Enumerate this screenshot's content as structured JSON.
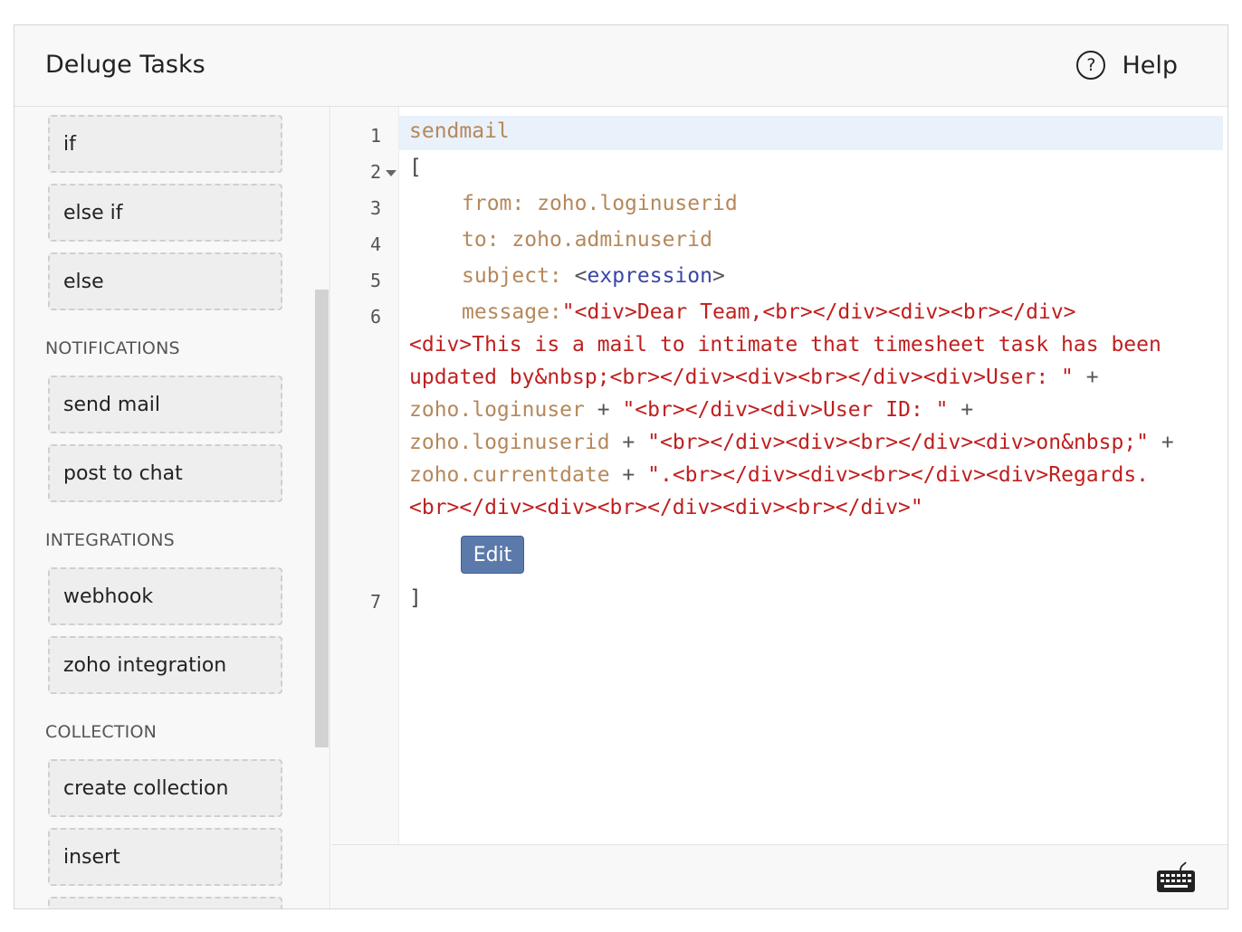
{
  "header": {
    "title": "Deluge Tasks",
    "help_label": "Help",
    "help_icon": "?"
  },
  "sidebar": {
    "tasks_top": [
      {
        "label": "if"
      },
      {
        "label": "else if"
      },
      {
        "label": "else"
      }
    ],
    "sections": [
      {
        "label": "NOTIFICATIONS",
        "items": [
          {
            "label": "send mail"
          },
          {
            "label": "post to chat"
          }
        ]
      },
      {
        "label": "INTEGRATIONS",
        "items": [
          {
            "label": "webhook"
          },
          {
            "label": "zoho integration"
          }
        ]
      },
      {
        "label": "COLLECTION",
        "items": [
          {
            "label": "create collection"
          },
          {
            "label": "insert"
          }
        ]
      }
    ]
  },
  "editor": {
    "line_numbers": [
      "1",
      "2",
      "3",
      "4",
      "5",
      "6",
      "7"
    ],
    "line1": "sendmail",
    "line2": "[",
    "line3_key": "from:",
    "line3_val": "zoho.loginuserid",
    "line4_key": "to:",
    "line4_val": "zoho.adminuserid",
    "line5_key": "subject:",
    "line5_lt": "<",
    "line5_tag": "expression",
    "line5_gt": ">",
    "line6_key": "message:",
    "line6_str1": "\"<div>Dear Team,<br></div><div><br></div>",
    "wrap1": "<div>This is a mail to intimate that timesheet task has been",
    "wrap2_str": "updated by&nbsp;<br></div><div><br></div><div>User: \"",
    "plus": "+",
    "wrap3_var": "zoho.loginuser",
    "wrap3_str": "\"<br></div><div>User ID: \"",
    "wrap4_var": "zoho.loginuserid",
    "wrap4_str": "\"<br></div><div><br></div><div>on&nbsp;\"",
    "wrap5_var": "zoho.currentdate",
    "wrap5_str": "\".<br></div><div><br></div><div>Regards.",
    "wrap6_str": "<br></div><div><br></div><div><br></div>\"",
    "edit_label": "Edit",
    "line7": "]"
  },
  "footer": {
    "keyboard_icon": "keyboard-icon"
  }
}
